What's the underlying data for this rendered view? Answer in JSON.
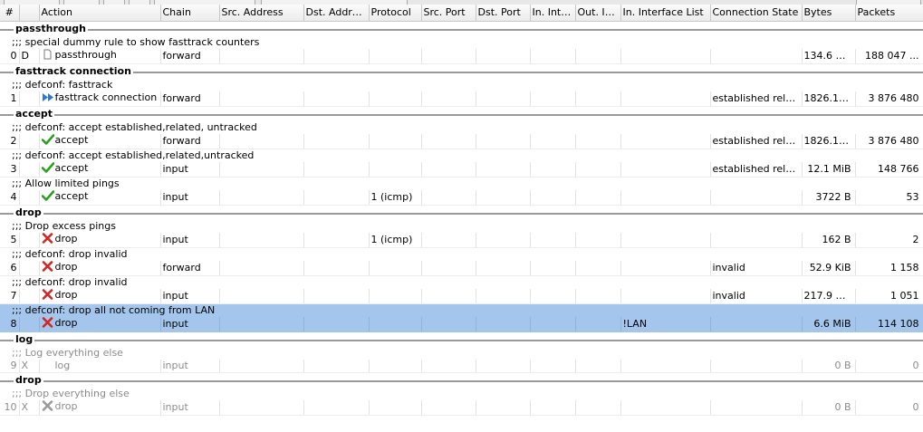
{
  "columns": [
    "#",
    "",
    "Action",
    "Chain",
    "Src. Address",
    "Dst. Address",
    "Protocol",
    "Src. Port",
    "Dst. Port",
    "In. Inter...",
    "Out. Int...",
    "In. Interface List",
    "Connection State",
    "Bytes",
    "Packets"
  ],
  "sections": [
    {
      "label": "passthrough",
      "rules": [
        {
          "comment": ";;; special dummy rule to show fasttrack counters",
          "num": "0",
          "flag": "D",
          "action": "passthrough",
          "icon": "dummy-page-icon",
          "chain": "forward",
          "protocol": "",
          "in_iface_list": "",
          "state": "",
          "bytes": "134.6 GiB",
          "packets": "188 047 ..."
        }
      ]
    },
    {
      "label": "fasttrack connection",
      "rules": [
        {
          "comment": ";;; defconf: fasttrack",
          "num": "1",
          "flag": "",
          "action": "fasttrack connection",
          "icon": "fasttrack-icon",
          "chain": "forward",
          "protocol": "",
          "in_iface_list": "",
          "state": "established related",
          "bytes": "1826.1 MiB",
          "packets": "3 876 480"
        }
      ]
    },
    {
      "label": "accept",
      "rules": [
        {
          "comment": ";;; defconf: accept established,related, untracked",
          "num": "2",
          "flag": "",
          "action": "accept",
          "icon": "accept-check-icon",
          "chain": "forward",
          "protocol": "",
          "in_iface_list": "",
          "state": "established relate...",
          "bytes": "1826.1 MiB",
          "packets": "3 876 480"
        },
        {
          "comment": ";;; defconf: accept established,related,untracked",
          "num": "3",
          "flag": "",
          "action": "accept",
          "icon": "accept-check-icon",
          "chain": "input",
          "protocol": "",
          "in_iface_list": "",
          "state": "established relate...",
          "bytes": "12.1 MiB",
          "packets": "148 766"
        },
        {
          "comment": ";;; Allow limited pings",
          "num": "4",
          "flag": "",
          "action": "accept",
          "icon": "accept-check-icon",
          "chain": "input",
          "protocol": "1 (icmp)",
          "in_iface_list": "",
          "state": "",
          "bytes": "3722 B",
          "packets": "53"
        }
      ]
    },
    {
      "label": "drop",
      "rules": [
        {
          "comment": ";;; Drop excess pings",
          "num": "5",
          "flag": "",
          "action": "drop",
          "icon": "drop-x-icon",
          "chain": "input",
          "protocol": "1 (icmp)",
          "in_iface_list": "",
          "state": "",
          "bytes": "162 B",
          "packets": "2"
        },
        {
          "comment": ";;; defconf: drop invalid",
          "num": "6",
          "flag": "",
          "action": "drop",
          "icon": "drop-x-icon",
          "chain": "forward",
          "protocol": "",
          "in_iface_list": "",
          "state": "invalid",
          "bytes": "52.9 KiB",
          "packets": "1 158"
        },
        {
          "comment": ";;; defconf: drop invalid",
          "num": "7",
          "flag": "",
          "action": "drop",
          "icon": "drop-x-icon",
          "chain": "input",
          "protocol": "",
          "in_iface_list": "",
          "state": "invalid",
          "bytes": "217.9 KiB",
          "packets": "1 051"
        },
        {
          "comment": ";;; defconf: drop all not coming from LAN",
          "num": "8",
          "flag": "",
          "action": "drop",
          "icon": "drop-x-icon",
          "chain": "input",
          "protocol": "",
          "in_iface_list": "!LAN",
          "state": "",
          "bytes": "6.6 MiB",
          "packets": "114 108",
          "selected": true
        }
      ]
    },
    {
      "label": "log",
      "rules": [
        {
          "comment": ";;; Log everything else",
          "num": "9",
          "flag": "X",
          "action": "log",
          "icon": "",
          "chain": "input",
          "protocol": "",
          "in_iface_list": "",
          "state": "",
          "bytes": "0 B",
          "packets": "0",
          "disabled": true
        }
      ]
    },
    {
      "label": "drop",
      "rules": [
        {
          "comment": ";;; Drop everything else",
          "num": "10",
          "flag": "X",
          "action": "drop",
          "icon": "drop-x-gray-icon",
          "chain": "input",
          "protocol": "",
          "in_iface_list": "",
          "state": "",
          "bytes": "0 B",
          "packets": "0",
          "disabled": true
        }
      ]
    }
  ],
  "colors": {
    "selected_row": "#a4c6ec",
    "accept_green": "#2e9e23",
    "drop_red": "#d42424",
    "fasttrack_blue": "#2a78d4",
    "disabled_text": "#8c8c8c"
  }
}
